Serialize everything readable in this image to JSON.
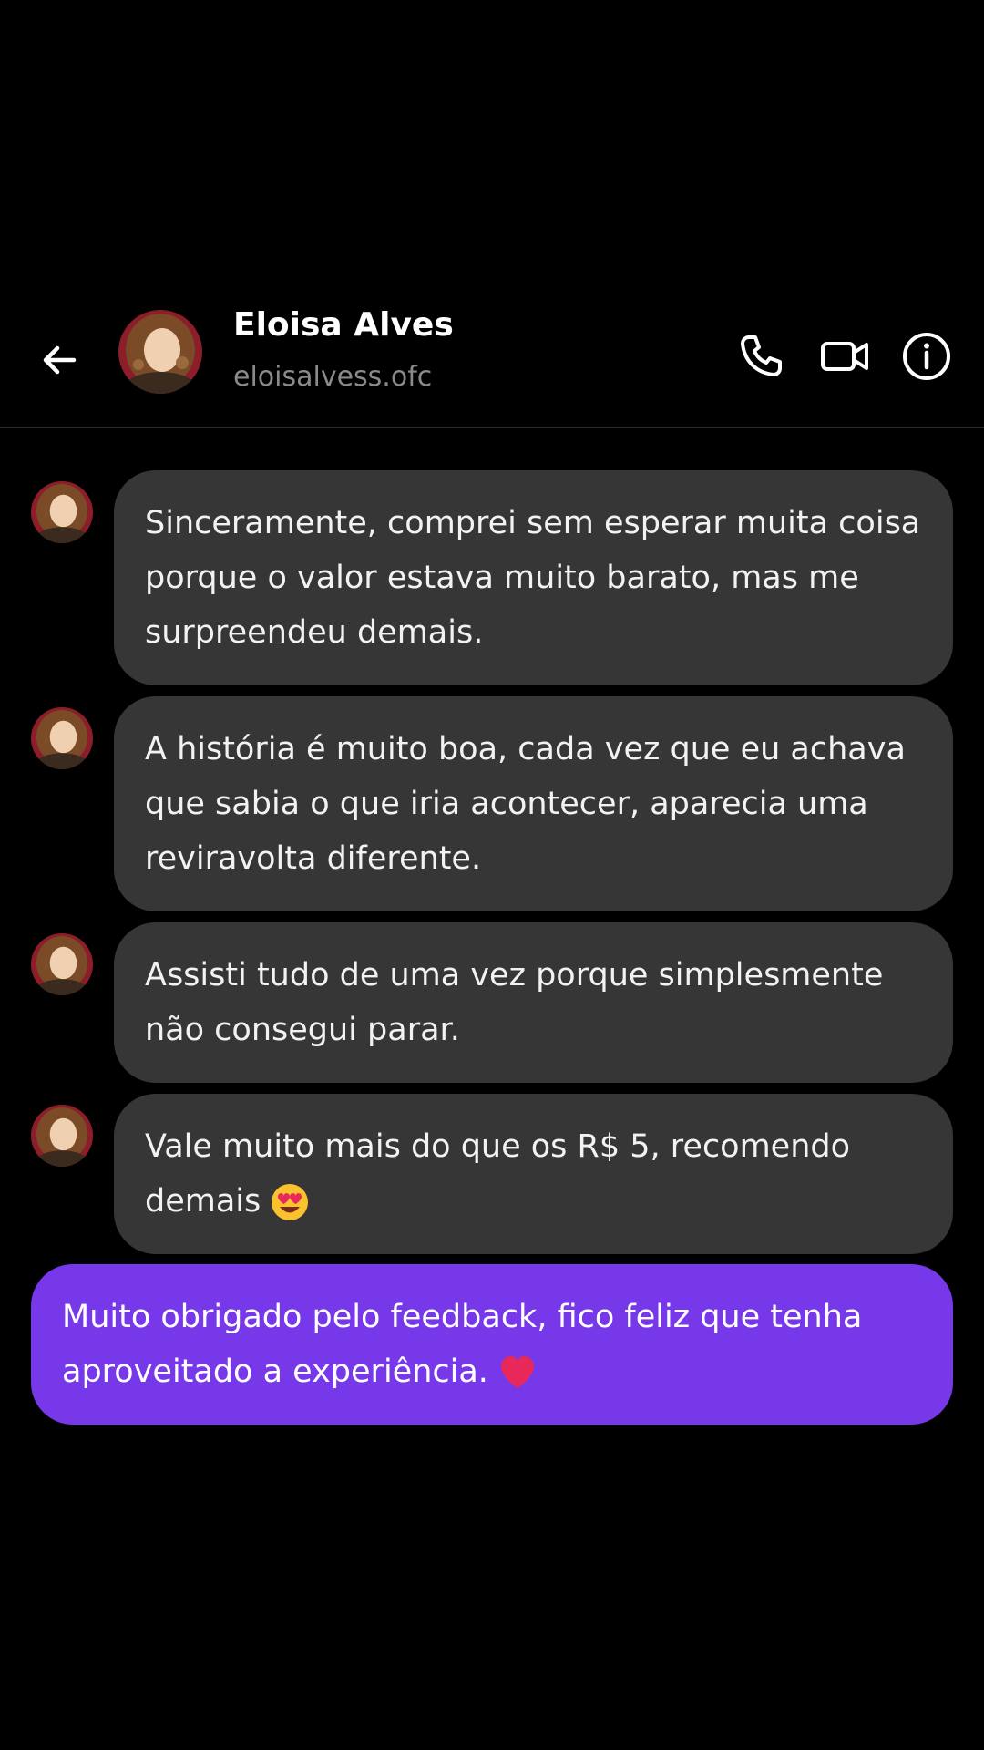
{
  "header": {
    "back_icon": "arrow-left-icon",
    "name": "Eloisa Alves",
    "handle": "eloisalvess.ofc",
    "call_icon": "phone-icon",
    "video_icon": "video-camera-icon",
    "info_icon": "info-icon"
  },
  "messages": [
    {
      "direction": "received",
      "text": "Sinceramente, comprei sem esperar muita coisa porque o valor estava muito barato, mas me surpreendeu demais."
    },
    {
      "direction": "received",
      "text": "A história é muito boa, cada vez que eu achava que sabia o que iria acontecer, aparecia uma reviravolta diferente."
    },
    {
      "direction": "received",
      "text": "Assisti tudo de uma vez porque simplesmente não consegui parar."
    },
    {
      "direction": "received",
      "text": "Vale muito mais do que os R$ 5, recomendo demais",
      "emoji": "heart-eyes-emoji"
    },
    {
      "direction": "sent",
      "text": "Muito obrigado pelo feedback, fico feliz que tenha aproveitado a experiência.",
      "emoji": "heart-emoji"
    }
  ],
  "colors": {
    "background": "#000000",
    "received_bubble": "#363636",
    "sent_bubble": "#7738ea",
    "handle_text": "#8a8a8a"
  }
}
